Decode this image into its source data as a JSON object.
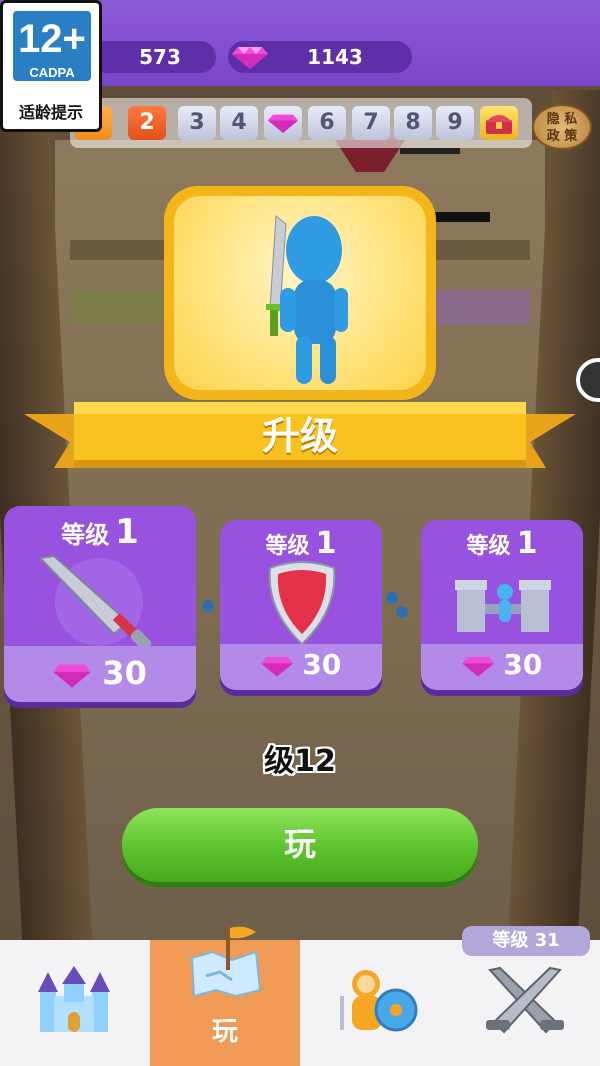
{
  "hud": {
    "coins": "573",
    "gems": "1143"
  },
  "age_rating": {
    "age": "12+",
    "org": "CADPA",
    "tip": "适龄提示"
  },
  "level_strip": {
    "levels": [
      "1",
      "2",
      "3",
      "4",
      "gem",
      "6",
      "7",
      "8",
      "9",
      "chest"
    ],
    "current": "2"
  },
  "privacy": {
    "line1": "隐 私",
    "line2": "政 策"
  },
  "ribbon": {
    "label": "升级"
  },
  "upgrades": [
    {
      "name": "sword",
      "level_word": "等级",
      "level": "1",
      "cost": "30"
    },
    {
      "name": "shield",
      "level_word": "等级",
      "level": "1",
      "cost": "30"
    },
    {
      "name": "fort",
      "level_word": "等级",
      "level": "1",
      "cost": "30"
    }
  ],
  "level_caption": "级12",
  "play_button": "玩",
  "player_level": "等级 31",
  "nav": {
    "items": [
      {
        "name": "castle",
        "label": ""
      },
      {
        "name": "map",
        "label": "玩"
      },
      {
        "name": "hero",
        "label": ""
      },
      {
        "name": "battle",
        "label": ""
      }
    ]
  },
  "colors": {
    "hud_purple": "#7a46c9",
    "gem_pink": "#f04bd8",
    "play_green": "#5cc42c",
    "card_purple": "#9753df",
    "ribbon_gold": "#f5b81c",
    "nav_active": "#f09a56"
  }
}
